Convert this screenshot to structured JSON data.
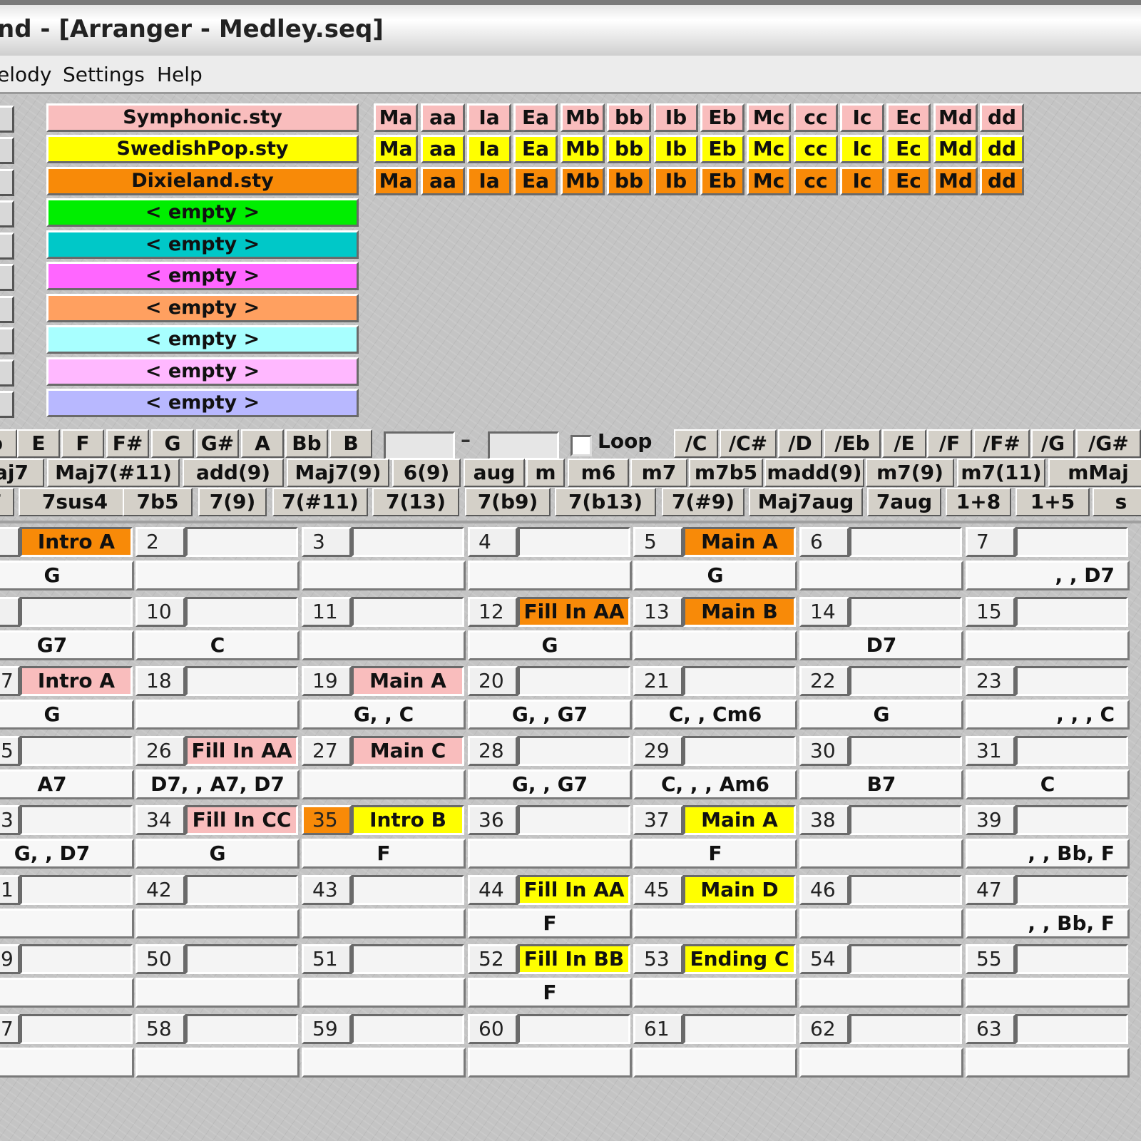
{
  "window": {
    "title": "nd - [Arranger - Medley.seq]"
  },
  "menu": [
    "elody",
    "Settings",
    "Help"
  ],
  "styles": [
    {
      "name": "Symphonic.sty",
      "color": "#f9bdbd"
    },
    {
      "name": "SwedishPop.sty",
      "color": "#ffff00"
    },
    {
      "name": "Dixieland.sty",
      "color": "#f88a08"
    },
    {
      "name": "< empty >",
      "color": "#00ee00"
    },
    {
      "name": "< empty >",
      "color": "#00c8c8"
    },
    {
      "name": "< empty >",
      "color": "#ff66ff"
    },
    {
      "name": "< empty >",
      "color": "#ffa060"
    },
    {
      "name": "< empty >",
      "color": "#a8ffff"
    },
    {
      "name": "< empty >",
      "color": "#ffb8ff"
    },
    {
      "name": "< empty >",
      "color": "#b8b8ff"
    }
  ],
  "style_variations": [
    "Ma",
    "aa",
    "Ia",
    "Ea",
    "Mb",
    "bb",
    "Ib",
    "Eb",
    "Mc",
    "cc",
    "Ic",
    "Ec",
    "Md",
    "dd"
  ],
  "root_notes": [
    "b",
    "E",
    "F",
    "F#",
    "G",
    "G#",
    "A",
    "Bb",
    "B"
  ],
  "loop_label": "Loop",
  "dash": "–",
  "bass_notes": [
    "/C",
    "/C#",
    "/D",
    "/Eb",
    "/E",
    "/F",
    "/F#",
    "/G",
    "/G#"
  ],
  "chord_types_1": [
    "aj7",
    "Maj7(#11)",
    "add(9)",
    "Maj7(9)",
    "6(9)",
    "aug",
    "m",
    "m6",
    "m7",
    "m7b5",
    "madd(9)",
    "m7(9)",
    "m7(11)",
    "mMaj"
  ],
  "chord_types_2": [
    "7",
    "7sus4",
    "7b5",
    "7(9)",
    "7(#11)",
    "7(13)",
    "7(b9)",
    "7(b13)",
    "7(#9)",
    "Maj7aug",
    "7aug",
    "1+8",
    "1+5",
    "s"
  ],
  "measures": [
    [
      {
        "num": "",
        "part": "Intro A",
        "color": "#f88a08",
        "chord": "G"
      },
      {
        "num": "2",
        "part": "",
        "color": "",
        "chord": ""
      },
      {
        "num": "3",
        "part": "",
        "color": "",
        "chord": ""
      },
      {
        "num": "4",
        "part": "",
        "color": "",
        "chord": ""
      },
      {
        "num": "5",
        "part": "Main A",
        "color": "#f88a08",
        "chord": "G"
      },
      {
        "num": "6",
        "part": "",
        "color": "",
        "chord": ""
      },
      {
        "num": "7",
        "part": "",
        "color": "",
        "chord": ", , D7"
      }
    ],
    [
      {
        "num": "",
        "part": "",
        "color": "",
        "chord": "G7"
      },
      {
        "num": "10",
        "part": "",
        "color": "",
        "chord": "C"
      },
      {
        "num": "11",
        "part": "",
        "color": "",
        "chord": ""
      },
      {
        "num": "12",
        "part": "Fill In AA",
        "color": "#f88a08",
        "chord": "G"
      },
      {
        "num": "13",
        "part": "Main B",
        "color": "#f88a08",
        "chord": ""
      },
      {
        "num": "14",
        "part": "",
        "color": "",
        "chord": "D7"
      },
      {
        "num": "15",
        "part": "",
        "color": "",
        "chord": ""
      }
    ],
    [
      {
        "num": "7",
        "part": "Intro A",
        "color": "#f9bdbd",
        "chord": "G"
      },
      {
        "num": "18",
        "part": "",
        "color": "",
        "chord": ""
      },
      {
        "num": "19",
        "part": "Main A",
        "color": "#f9bdbd",
        "chord": "G, , C"
      },
      {
        "num": "20",
        "part": "",
        "color": "",
        "chord": "G, , G7"
      },
      {
        "num": "21",
        "part": "",
        "color": "",
        "chord": "C, , Cm6"
      },
      {
        "num": "22",
        "part": "",
        "color": "",
        "chord": "G"
      },
      {
        "num": "23",
        "part": "",
        "color": "",
        "chord": ", , , C"
      }
    ],
    [
      {
        "num": "5",
        "part": "",
        "color": "",
        "chord": "A7"
      },
      {
        "num": "26",
        "part": "Fill In AA",
        "color": "#f9bdbd",
        "chord": "D7, , A7, D7"
      },
      {
        "num": "27",
        "part": "Main C",
        "color": "#f9bdbd",
        "chord": ""
      },
      {
        "num": "28",
        "part": "",
        "color": "",
        "chord": "G, , G7"
      },
      {
        "num": "29",
        "part": "",
        "color": "",
        "chord": "C, , , Am6"
      },
      {
        "num": "30",
        "part": "",
        "color": "",
        "chord": "B7"
      },
      {
        "num": "31",
        "part": "",
        "color": "",
        "chord": "C"
      }
    ],
    [
      {
        "num": "3",
        "part": "",
        "color": "",
        "chord": "G, , D7"
      },
      {
        "num": "34",
        "part": "Fill In CC",
        "color": "#f9bdbd",
        "chord": "G"
      },
      {
        "num": "35",
        "part": "Intro B",
        "color": "#ffff00",
        "chord": "F",
        "numColor": "#f88a08"
      },
      {
        "num": "36",
        "part": "",
        "color": "",
        "chord": ""
      },
      {
        "num": "37",
        "part": "Main A",
        "color": "#ffff00",
        "chord": "F"
      },
      {
        "num": "38",
        "part": "",
        "color": "",
        "chord": ""
      },
      {
        "num": "39",
        "part": "",
        "color": "",
        "chord": ", , Bb, F"
      }
    ],
    [
      {
        "num": "1",
        "part": "",
        "color": "",
        "chord": ""
      },
      {
        "num": "42",
        "part": "",
        "color": "",
        "chord": ""
      },
      {
        "num": "43",
        "part": "",
        "color": "",
        "chord": ""
      },
      {
        "num": "44",
        "part": "Fill In AA",
        "color": "#ffff00",
        "chord": "F"
      },
      {
        "num": "45",
        "part": "Main D",
        "color": "#ffff00",
        "chord": ""
      },
      {
        "num": "46",
        "part": "",
        "color": "",
        "chord": ""
      },
      {
        "num": "47",
        "part": "",
        "color": "",
        "chord": ", , Bb, F"
      }
    ],
    [
      {
        "num": "9",
        "part": "",
        "color": "",
        "chord": ""
      },
      {
        "num": "50",
        "part": "",
        "color": "",
        "chord": ""
      },
      {
        "num": "51",
        "part": "",
        "color": "",
        "chord": ""
      },
      {
        "num": "52",
        "part": "Fill In BB",
        "color": "#ffff00",
        "chord": "F"
      },
      {
        "num": "53",
        "part": "Ending C",
        "color": "#ffff00",
        "chord": ""
      },
      {
        "num": "54",
        "part": "",
        "color": "",
        "chord": ""
      },
      {
        "num": "55",
        "part": "",
        "color": "",
        "chord": ""
      }
    ],
    [
      {
        "num": "7",
        "part": "",
        "color": "",
        "chord": ""
      },
      {
        "num": "58",
        "part": "",
        "color": "",
        "chord": ""
      },
      {
        "num": "59",
        "part": "",
        "color": "",
        "chord": ""
      },
      {
        "num": "60",
        "part": "",
        "color": "",
        "chord": ""
      },
      {
        "num": "61",
        "part": "",
        "color": "",
        "chord": ""
      },
      {
        "num": "62",
        "part": "",
        "color": "",
        "chord": ""
      },
      {
        "num": "63",
        "part": "",
        "color": "",
        "chord": ""
      }
    ]
  ]
}
